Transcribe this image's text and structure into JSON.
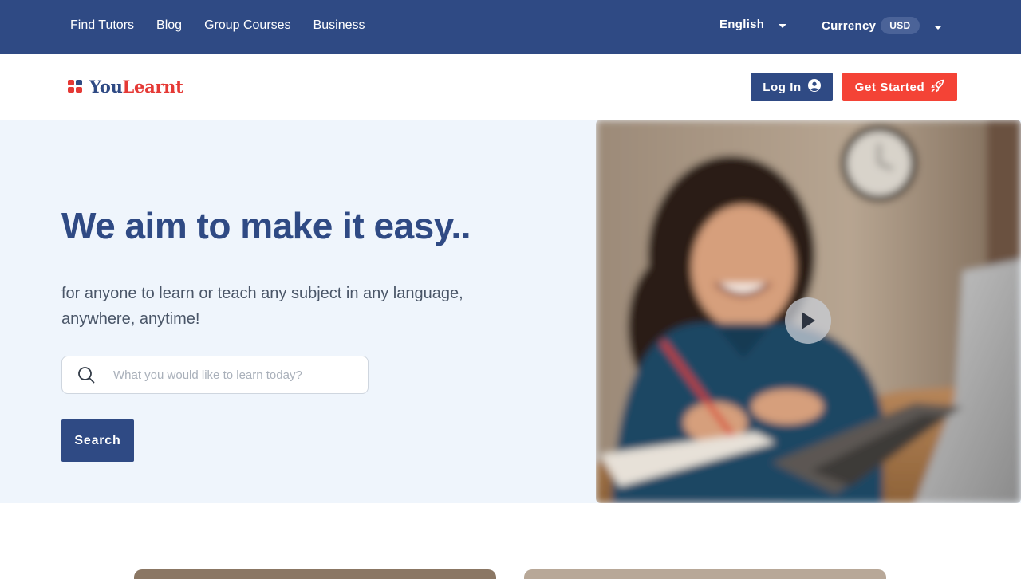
{
  "topbar": {
    "nav": [
      "Find Tutors",
      "Blog",
      "Group Courses",
      "Business"
    ],
    "language": "English",
    "currency_label": "Currency",
    "currency_value": "USD"
  },
  "header": {
    "logo_part1": "You",
    "logo_part2": "Learnt",
    "login_label": "Log In",
    "get_started_label": "Get Started"
  },
  "hero": {
    "title": "We aim to make it easy..",
    "subtitle": "for anyone to learn or teach any subject in any language, anywhere, anytime!",
    "search_placeholder": "What you would like to learn today?",
    "search_button": "Search"
  },
  "icons": {
    "login": "user-circle-icon",
    "get_started": "rocket-icon",
    "search": "search-icon",
    "play": "play-icon",
    "dropdown": "caret-down-icon"
  },
  "colors": {
    "primary": "#2f4a84",
    "accent": "#f44336",
    "hero_bg": "#eff5fc"
  }
}
